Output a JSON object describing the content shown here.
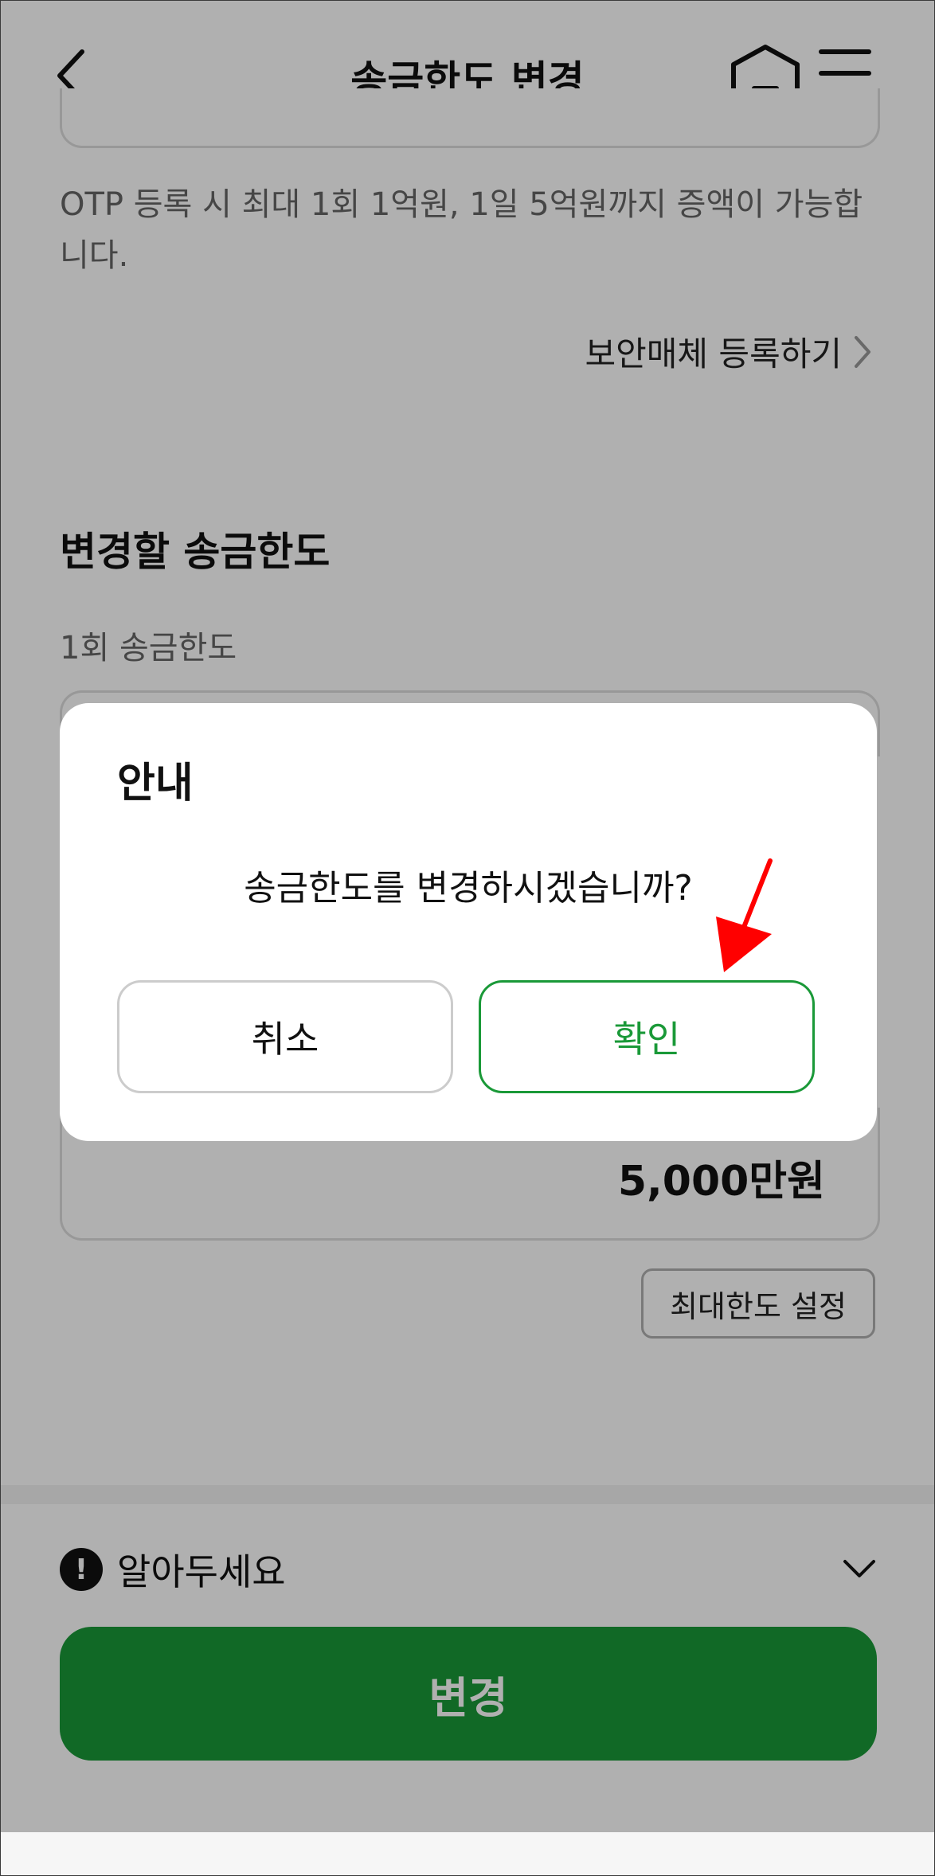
{
  "header": {
    "title": "송금한도 변경",
    "back_icon": "chevron-left-icon",
    "home_icon": "home-icon",
    "menu_icon": "hamburger-menu-icon"
  },
  "content": {
    "otp_note": "OTP 등록 시 최대 1회 1억원, 1일 5억원까지 증액이 가능합니다.",
    "register_link": "보안매체 등록하기",
    "section_title": "변경할 송금한도",
    "once_limit_label": "1회 송금한도",
    "amount_value": "5,000만원",
    "max_button": "최대한도 설정"
  },
  "notice": {
    "label": "알아두세요",
    "icon_text": "!"
  },
  "change_button": "변경",
  "dialog": {
    "title": "안내",
    "message": "송금한도를 변경하시겠습니까?",
    "cancel": "취소",
    "confirm": "확인"
  },
  "colors": {
    "primary_green": "#1a9938",
    "annotation_red": "#ff0000"
  }
}
